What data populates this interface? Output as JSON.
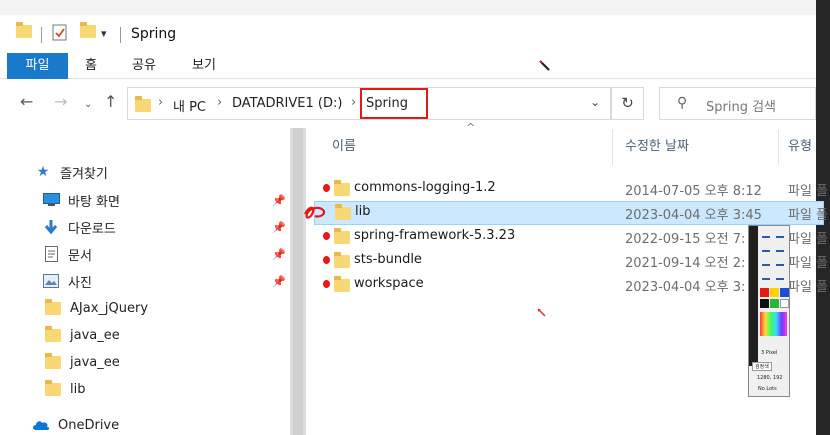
{
  "window": {
    "title": "Spring"
  },
  "ribbon": {
    "tabs": [
      "파일",
      "홈",
      "공유",
      "보기"
    ]
  },
  "address": {
    "segments": [
      "내 PC",
      "DATADRIVE1 (D:)",
      "Spring"
    ]
  },
  "search": {
    "placeholder": "Spring 검색"
  },
  "nav_pane": {
    "quick_access": "즐겨찾기",
    "items": [
      {
        "label": "바탕 화면",
        "icon": "desktop-icon",
        "pinned": true
      },
      {
        "label": "다운로드",
        "icon": "download-arrow-icon",
        "pinned": true
      },
      {
        "label": "문서",
        "icon": "document-icon",
        "pinned": true
      },
      {
        "label": "사진",
        "icon": "pictures-icon",
        "pinned": true
      },
      {
        "label": "AJax_jQuery",
        "icon": "folder-icon",
        "pinned": false
      },
      {
        "label": "java_ee",
        "icon": "folder-icon",
        "pinned": false
      },
      {
        "label": "java_ee",
        "icon": "folder-icon",
        "pinned": false
      },
      {
        "label": "lib",
        "icon": "folder-icon",
        "pinned": false
      }
    ],
    "onedrive": "OneDrive"
  },
  "columns": {
    "name": "이름",
    "modified": "수정한 날짜",
    "type": "유형"
  },
  "files": [
    {
      "name": "commons-logging-1.2",
      "modified": "2014-07-05 오후 8:12",
      "type": "파일 폴",
      "selected": false
    },
    {
      "name": "lib",
      "modified": "2023-04-04 오후 3:45",
      "type": "파일 폴",
      "selected": true
    },
    {
      "name": "spring-framework-5.3.23",
      "modified": "2022-09-15 오전 7:",
      "type": "파일 폴",
      "selected": false
    },
    {
      "name": "sts-bundle",
      "modified": "2021-09-14 오전 2:",
      "type": "파일 폴",
      "selected": false
    },
    {
      "name": "workspace",
      "modified": "2023-04-04 오후 3:",
      "type": "파일 폴",
      "selected": false
    }
  ],
  "palette": {
    "width_label": "3 Pixel",
    "mode_label": "검정색",
    "coords": "1280, 192",
    "status": "No Lots"
  },
  "colors": {
    "accent": "#1979ca",
    "selection": "#cce8ff",
    "annotation_red": "#e81818",
    "folder": "#f8d775"
  }
}
